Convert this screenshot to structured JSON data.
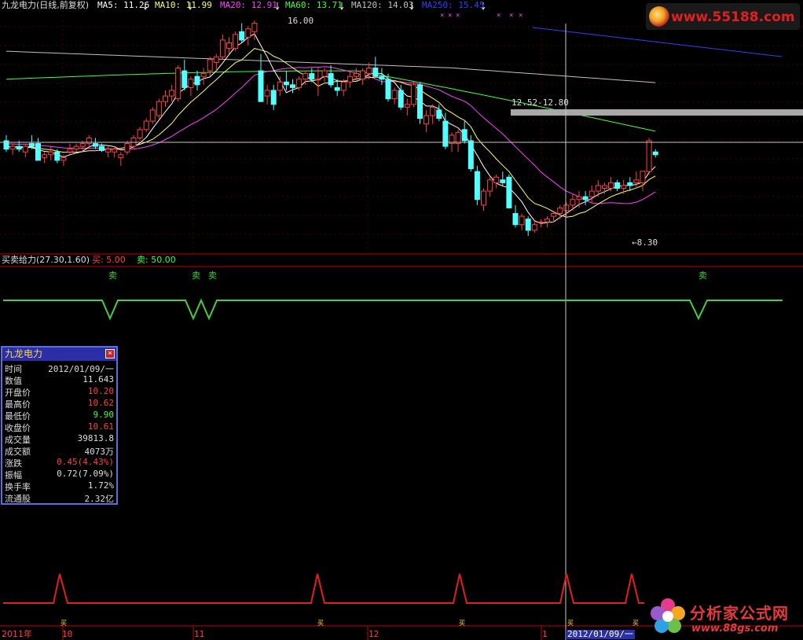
{
  "colors": {
    "up": "#ff4040",
    "down": "#54ffff",
    "ma5": "#ffffff",
    "ma10": "#ffff60",
    "ma20": "#ff40ff",
    "ma60": "#40ff40",
    "ma120": "#c0c0c0",
    "ma250": "#3040ff",
    "signal_green": "#40d040",
    "signal_red": "#e02020",
    "bg": "#000000",
    "panel_border": "#c00000",
    "crosshair": "#c8c8c8"
  },
  "header": {
    "stock": "九龙电力(日线,前复权)",
    "ma5": "MA5: 11.26",
    "ma10": "MA10: 11.99",
    "ma20": "MA20: 12.91",
    "ma60": "MA60: 13.71",
    "ma120": "MA120: 14.03",
    "ma250": "MA250: 15.45"
  },
  "main": {
    "high_mark": "16.00",
    "low_mark": "←8.30",
    "range_mark": "12.52-12.80"
  },
  "indicator": {
    "title": "买卖给力(27.30,1.60)",
    "buy": "买: 5.00",
    "sell": "卖: 50.00",
    "sell_label": "卖"
  },
  "bottom": {
    "marker": "买"
  },
  "xaxis": {
    "year": "2011年",
    "m10": "10",
    "m11": "11",
    "m12": "12",
    "m1": "1",
    "cursor_date": "2012/01/09/一"
  },
  "infobox": {
    "title": "九龙电力",
    "rows": [
      {
        "k": "时间",
        "v": "2012/01/09/一",
        "c": "#dddddd"
      },
      {
        "k": "数值",
        "v": "11.643",
        "c": "#dddddd"
      },
      {
        "k": "开盘价",
        "v": "10.20",
        "c": "#ff4040"
      },
      {
        "k": "最高价",
        "v": "10.62",
        "c": "#ff4040"
      },
      {
        "k": "最低价",
        "v": "9.90",
        "c": "#40ff40"
      },
      {
        "k": "收盘价",
        "v": "10.61",
        "c": "#ff4040"
      },
      {
        "k": "成交量",
        "v": "39813.8",
        "c": "#dddddd"
      },
      {
        "k": "成交额",
        "v": "4073万",
        "c": "#dddddd"
      },
      {
        "k": "涨跌",
        "v": "0.45(4.43%)",
        "c": "#ff4040"
      },
      {
        "k": "振幅",
        "v": "0.72(7.09%)",
        "c": "#dddddd"
      },
      {
        "k": "换手率",
        "v": "1.72%",
        "c": "#dddddd"
      },
      {
        "k": "流通股",
        "v": "2.32亿",
        "c": "#dddddd"
      }
    ]
  },
  "watermarks": {
    "top": "www.55188.com",
    "bottom_cn": "分析家公式网",
    "bottom_url": "www.88gs.com"
  },
  "candles": [
    [
      11.7,
      11.9,
      11.3,
      11.4
    ],
    [
      11.4,
      11.6,
      11.2,
      11.5
    ],
    [
      11.5,
      11.7,
      11.3,
      11.4
    ],
    [
      11.3,
      11.6,
      11.1,
      11.5
    ],
    [
      11.6,
      11.9,
      11.4,
      11.5
    ],
    [
      11.6,
      11.8,
      11.0,
      11.0
    ],
    [
      11.1,
      11.3,
      10.9,
      11.2
    ],
    [
      11.2,
      11.5,
      11.0,
      11.3
    ],
    [
      11.3,
      11.4,
      10.9,
      11.0
    ],
    [
      11.0,
      11.2,
      10.8,
      11.1
    ],
    [
      11.3,
      11.6,
      11.2,
      11.4
    ],
    [
      11.4,
      11.6,
      11.3,
      11.5
    ],
    [
      11.5,
      11.7,
      11.3,
      11.6
    ],
    [
      11.6,
      11.9,
      11.4,
      11.8
    ],
    [
      11.6,
      11.8,
      11.4,
      11.5
    ],
    [
      11.5,
      11.6,
      11.3,
      11.35
    ],
    [
      11.3,
      11.5,
      11.1,
      11.4
    ],
    [
      11.3,
      11.5,
      11.1,
      11.4
    ],
    [
      11.1,
      11.3,
      10.8,
      11.2
    ],
    [
      11.3,
      11.7,
      11.2,
      11.6
    ],
    [
      11.5,
      11.9,
      11.4,
      11.8
    ],
    [
      11.8,
      12.2,
      11.7,
      12.1
    ],
    [
      12.1,
      12.5,
      12.0,
      12.4
    ],
    [
      12.4,
      12.9,
      12.3,
      12.8
    ],
    [
      12.6,
      13.2,
      12.5,
      13.1
    ],
    [
      13.1,
      13.5,
      12.9,
      13.3
    ],
    [
      13.3,
      13.7,
      13.1,
      13.5
    ],
    [
      13.2,
      14.4,
      13.1,
      14.3
    ],
    [
      14.2,
      14.6,
      13.5,
      13.6
    ],
    [
      13.6,
      14.0,
      13.3,
      13.9
    ],
    [
      14.0,
      14.2,
      13.5,
      13.7
    ],
    [
      14.0,
      14.3,
      13.7,
      14.1
    ],
    [
      14.2,
      14.7,
      14.0,
      14.6
    ],
    [
      14.5,
      14.8,
      14.2,
      14.7
    ],
    [
      14.7,
      15.5,
      14.6,
      15.3
    ],
    [
      15.0,
      15.4,
      14.8,
      15.2
    ],
    [
      15.0,
      15.6,
      14.9,
      15.5
    ],
    [
      15.6,
      15.9,
      15.2,
      15.3
    ],
    [
      15.4,
      15.8,
      15.1,
      15.7
    ],
    [
      15.6,
      16.0,
      15.3,
      15.9
    ],
    [
      14.2,
      14.8,
      13.1,
      13.1
    ],
    [
      13.3,
      13.7,
      13.0,
      13.5
    ],
    [
      13.5,
      13.7,
      12.8,
      13.0
    ],
    [
      13.5,
      14.0,
      13.3,
      13.8
    ],
    [
      13.8,
      14.2,
      13.5,
      13.7
    ],
    [
      13.7,
      13.9,
      13.4,
      13.6
    ],
    [
      13.6,
      14.0,
      13.5,
      13.9
    ],
    [
      13.9,
      14.2,
      13.7,
      14.1
    ],
    [
      14.1,
      14.3,
      13.8,
      13.9
    ],
    [
      13.9,
      14.3,
      13.3,
      13.9
    ],
    [
      14.0,
      14.3,
      13.8,
      14.2
    ],
    [
      14.1,
      14.4,
      13.6,
      13.7
    ],
    [
      13.6,
      13.9,
      13.3,
      13.5
    ],
    [
      13.5,
      13.9,
      13.3,
      13.8
    ],
    [
      13.8,
      14.2,
      13.6,
      14.0
    ],
    [
      14.0,
      14.3,
      13.8,
      14.1
    ],
    [
      13.9,
      14.3,
      13.7,
      14.2
    ],
    [
      14.1,
      14.5,
      13.9,
      14.3
    ],
    [
      14.3,
      14.7,
      14.1,
      14.0
    ],
    [
      14.0,
      14.3,
      13.7,
      13.9
    ],
    [
      13.9,
      14.1,
      13.1,
      13.2
    ],
    [
      13.2,
      13.6,
      13.0,
      13.5
    ],
    [
      13.5,
      13.7,
      12.8,
      12.9
    ],
    [
      12.9,
      13.2,
      12.6,
      13.0
    ],
    [
      13.0,
      13.8,
      12.9,
      13.7
    ],
    [
      13.7,
      13.8,
      12.3,
      12.5
    ],
    [
      12.3,
      12.8,
      12.0,
      12.6
    ],
    [
      12.6,
      13.0,
      12.3,
      12.9
    ],
    [
      12.8,
      13.0,
      12.4,
      12.5
    ],
    [
      12.4,
      12.7,
      11.4,
      11.5
    ],
    [
      11.6,
      12.0,
      11.3,
      11.9
    ],
    [
      11.6,
      12.1,
      11.3,
      12.0
    ],
    [
      12.1,
      12.4,
      11.6,
      11.7
    ],
    [
      11.7,
      11.9,
      10.6,
      10.7
    ],
    [
      10.6,
      10.8,
      9.4,
      9.6
    ],
    [
      9.4,
      10.0,
      9.2,
      9.9
    ],
    [
      9.9,
      10.4,
      9.7,
      10.3
    ],
    [
      10.2,
      10.5,
      10.0,
      10.4
    ],
    [
      10.3,
      10.6,
      10.1,
      10.2
    ],
    [
      10.4,
      10.5,
      9.3,
      9.3
    ],
    [
      9.1,
      9.4,
      8.6,
      8.7
    ],
    [
      8.7,
      9.1,
      8.5,
      9.0
    ],
    [
      8.9,
      9.0,
      8.3,
      8.5
    ],
    [
      8.5,
      8.8,
      8.4,
      8.7
    ],
    [
      8.8,
      8.9,
      8.6,
      8.8
    ],
    [
      8.8,
      9.0,
      8.6,
      8.9
    ],
    [
      9.0,
      9.2,
      8.8,
      9.1
    ],
    [
      9.1,
      9.4,
      8.9,
      9.3
    ],
    [
      9.2,
      9.5,
      9.0,
      9.4
    ],
    [
      9.4,
      9.8,
      9.2,
      9.6
    ],
    [
      9.6,
      9.9,
      9.3,
      9.7
    ],
    [
      9.7,
      9.9,
      9.4,
      9.6
    ],
    [
      9.7,
      10.1,
      9.5,
      9.9
    ],
    [
      9.9,
      10.3,
      9.7,
      10.1
    ],
    [
      10.0,
      10.2,
      9.8,
      10.1
    ],
    [
      10.0,
      10.4,
      9.9,
      10.2
    ],
    [
      10.2,
      10.3,
      9.9,
      10.0
    ],
    [
      10.0,
      10.3,
      9.8,
      10.1
    ],
    [
      10.2,
      10.4,
      9.9,
      10.1
    ],
    [
      10.2,
      10.6,
      10.0,
      10.3
    ],
    [
      10.2,
      10.62,
      9.9,
      10.61
    ],
    [
      10.6,
      11.8,
      10.5,
      11.7
    ],
    [
      11.3,
      11.4,
      11.1,
      11.2
    ]
  ]
}
